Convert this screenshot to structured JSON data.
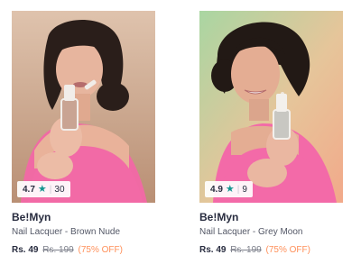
{
  "products": [
    {
      "rating": "4.7",
      "rating_count": "30",
      "brand": "Be!Myn",
      "name": "Nail Lacquer - Brown Nude",
      "price": "Rs. 49",
      "mrp": "Rs. 199",
      "discount": "(75% OFF)",
      "polish_color": "#c9a493",
      "bg_top": "#dfc3ad",
      "bg_bottom": "#b98f74"
    },
    {
      "rating": "4.9",
      "rating_count": "9",
      "brand": "Be!Myn",
      "name": "Nail Lacquer - Grey Moon",
      "price": "Rs. 49",
      "mrp": "Rs. 199",
      "discount": "(75% OFF)",
      "polish_color": "#c8c7c2",
      "bg_top": "#a9d6a2",
      "bg_bottom": "#f2a98a"
    }
  ],
  "colors": {
    "star": "#14958f",
    "discount": "#ff905a",
    "text_primary": "#282c3f",
    "text_secondary": "#535766"
  }
}
